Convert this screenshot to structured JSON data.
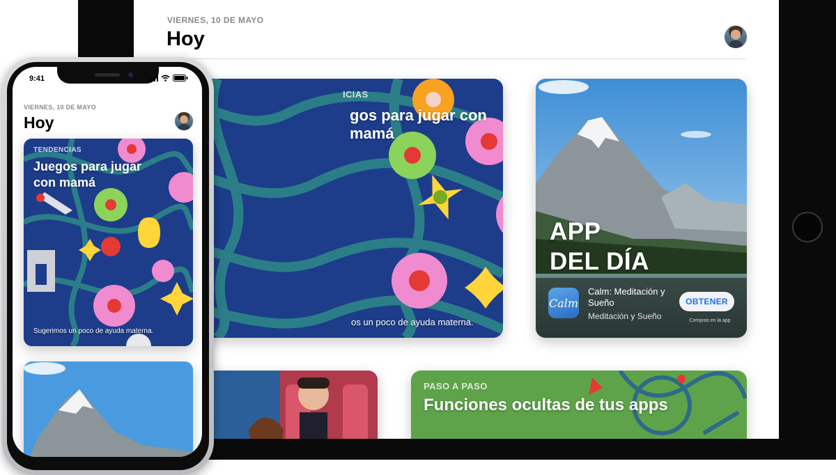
{
  "ipad": {
    "date": "VIERNES, 10 DE MAYO",
    "title": "Hoy",
    "featured_card": {
      "label": "TENDENCIAS",
      "label_visible": "ICIAS",
      "heading_visible": "gos para jugar con mamá",
      "caption_visible": "os un poco de ayuda materna."
    },
    "app_of_day": {
      "title_line1": "APP",
      "title_line2": "DEL DÍA",
      "app_icon_text": "Calm",
      "app_name": "Calm: Meditación y Sueño",
      "app_subtitle": "Meditación y Sueño",
      "get_button": "OBTENER",
      "purchase_note": "Compras en la app"
    },
    "paso_card": {
      "label": "PASO A PASO",
      "heading": "Funciones ocultas de tus apps"
    }
  },
  "iphone": {
    "time": "9:41",
    "date": "VIERNES, 10 DE MAYO",
    "title": "Hoy",
    "featured_card": {
      "label": "TENDENCIAS",
      "heading": "Juegos para jugar con mamá",
      "caption": "Sugerimos un poco de ayuda materna."
    }
  },
  "colors": {
    "pattern_bg": "#1d3d8a",
    "get_button_text": "#1a73e8",
    "paso_bg": "#5ea34a",
    "cinema_bg": "#7a2230"
  },
  "icons": [
    "signal-icon",
    "wifi-icon",
    "battery-icon",
    "user-avatar"
  ]
}
